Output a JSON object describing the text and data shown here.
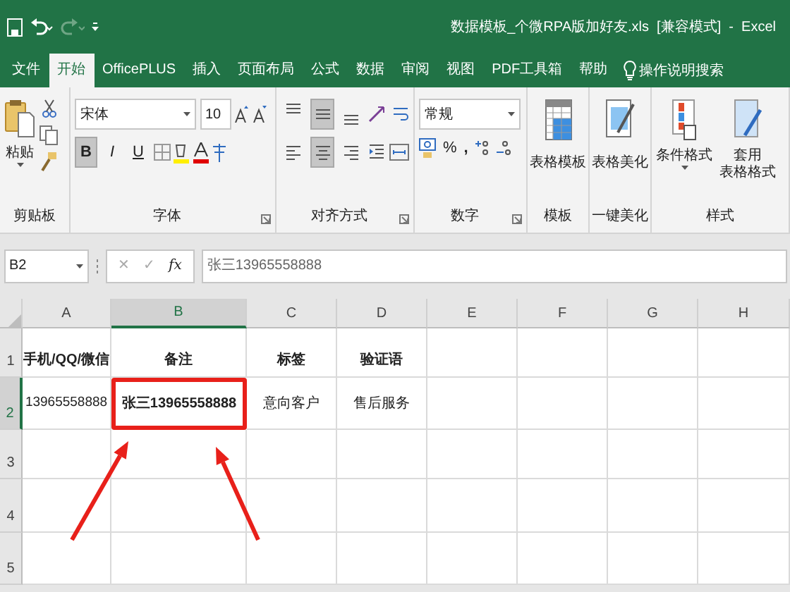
{
  "window": {
    "title": "数据模板_个微RPA版加好友.xls  [兼容模式]  -  Excel"
  },
  "quick_access": [
    {
      "kind": "save",
      "disabled": false
    },
    {
      "kind": "undo",
      "disabled": false
    },
    {
      "kind": "redo",
      "disabled": true
    },
    {
      "kind": "customize",
      "disabled": false
    }
  ],
  "tabs": [
    {
      "label": "文件",
      "selected": false
    },
    {
      "label": "开始",
      "selected": true
    },
    {
      "label": "OfficePLUS",
      "selected": false
    },
    {
      "label": "插入",
      "selected": false
    },
    {
      "label": "页面布局",
      "selected": false
    },
    {
      "label": "公式",
      "selected": false
    },
    {
      "label": "数据",
      "selected": false
    },
    {
      "label": "审阅",
      "selected": false
    },
    {
      "label": "视图",
      "selected": false
    },
    {
      "label": "PDF工具箱",
      "selected": false
    },
    {
      "label": "帮助",
      "selected": false
    }
  ],
  "tell_me": {
    "label": "操作说明搜索"
  },
  "ribbon": {
    "groups": [
      {
        "kind": "clipboard",
        "label": "剪贴板",
        "paste": "粘贴"
      },
      {
        "kind": "font",
        "label": "字体",
        "font_name": "宋体",
        "font_size": "10",
        "styles": [
          {
            "text": "B",
            "on": true
          },
          {
            "text": "I",
            "on": false
          },
          {
            "text": "U",
            "on": false
          }
        ]
      },
      {
        "kind": "alignment",
        "label": "对齐方式",
        "vertical_buttons": [
          {
            "kind": "top",
            "on": false
          },
          {
            "kind": "middle",
            "on": true
          },
          {
            "kind": "bottom",
            "on": false
          }
        ],
        "horizontal_buttons": [
          {
            "kind": "left",
            "on": false
          },
          {
            "kind": "center",
            "on": true
          },
          {
            "kind": "right",
            "on": false
          }
        ]
      },
      {
        "kind": "number",
        "label": "数字",
        "format": "常规",
        "percent": "%",
        "comma": ","
      },
      {
        "kind": "template",
        "label": "模板",
        "button": "表格模板"
      },
      {
        "kind": "beautify",
        "label": "一键美化",
        "button": "表格美化"
      },
      {
        "kind": "styles",
        "label": "样式",
        "conditional": "条件格式",
        "table_format": [
          "套用",
          "表格格式"
        ]
      }
    ]
  },
  "formula_bar": {
    "name_box": "B2",
    "cancel": "✕",
    "enter": "✓",
    "function": "fx",
    "value": "张三13965558888"
  },
  "sheet": {
    "columns": [
      {
        "label": "A",
        "selected": false
      },
      {
        "label": "B",
        "selected": true
      },
      {
        "label": "C",
        "selected": false
      },
      {
        "label": "D",
        "selected": false
      },
      {
        "label": "E",
        "selected": false
      },
      {
        "label": "F",
        "selected": false
      },
      {
        "label": "G",
        "selected": false
      },
      {
        "label": "H",
        "selected": false
      }
    ],
    "rows": [
      {
        "label": "1",
        "selected": false,
        "cells": [
          {
            "text": "手机/QQ/微信",
            "bold": true,
            "highlighted": false
          },
          {
            "text": "备注",
            "bold": true,
            "highlighted": false
          },
          {
            "text": "标签",
            "bold": true,
            "highlighted": false
          },
          {
            "text": "验证语",
            "bold": true,
            "highlighted": false
          }
        ]
      },
      {
        "label": "2",
        "selected": true,
        "cells": [
          {
            "text": "13965558888",
            "bold": false,
            "highlighted": false
          },
          {
            "text": "张三13965558888",
            "bold": true,
            "highlighted": true
          },
          {
            "text": "意向客户",
            "bold": false,
            "highlighted": false
          },
          {
            "text": "售后服务",
            "bold": false,
            "highlighted": false
          }
        ]
      },
      {
        "label": "3",
        "selected": false
      },
      {
        "label": "4",
        "selected": false
      },
      {
        "label": "5",
        "selected": false
      }
    ]
  }
}
